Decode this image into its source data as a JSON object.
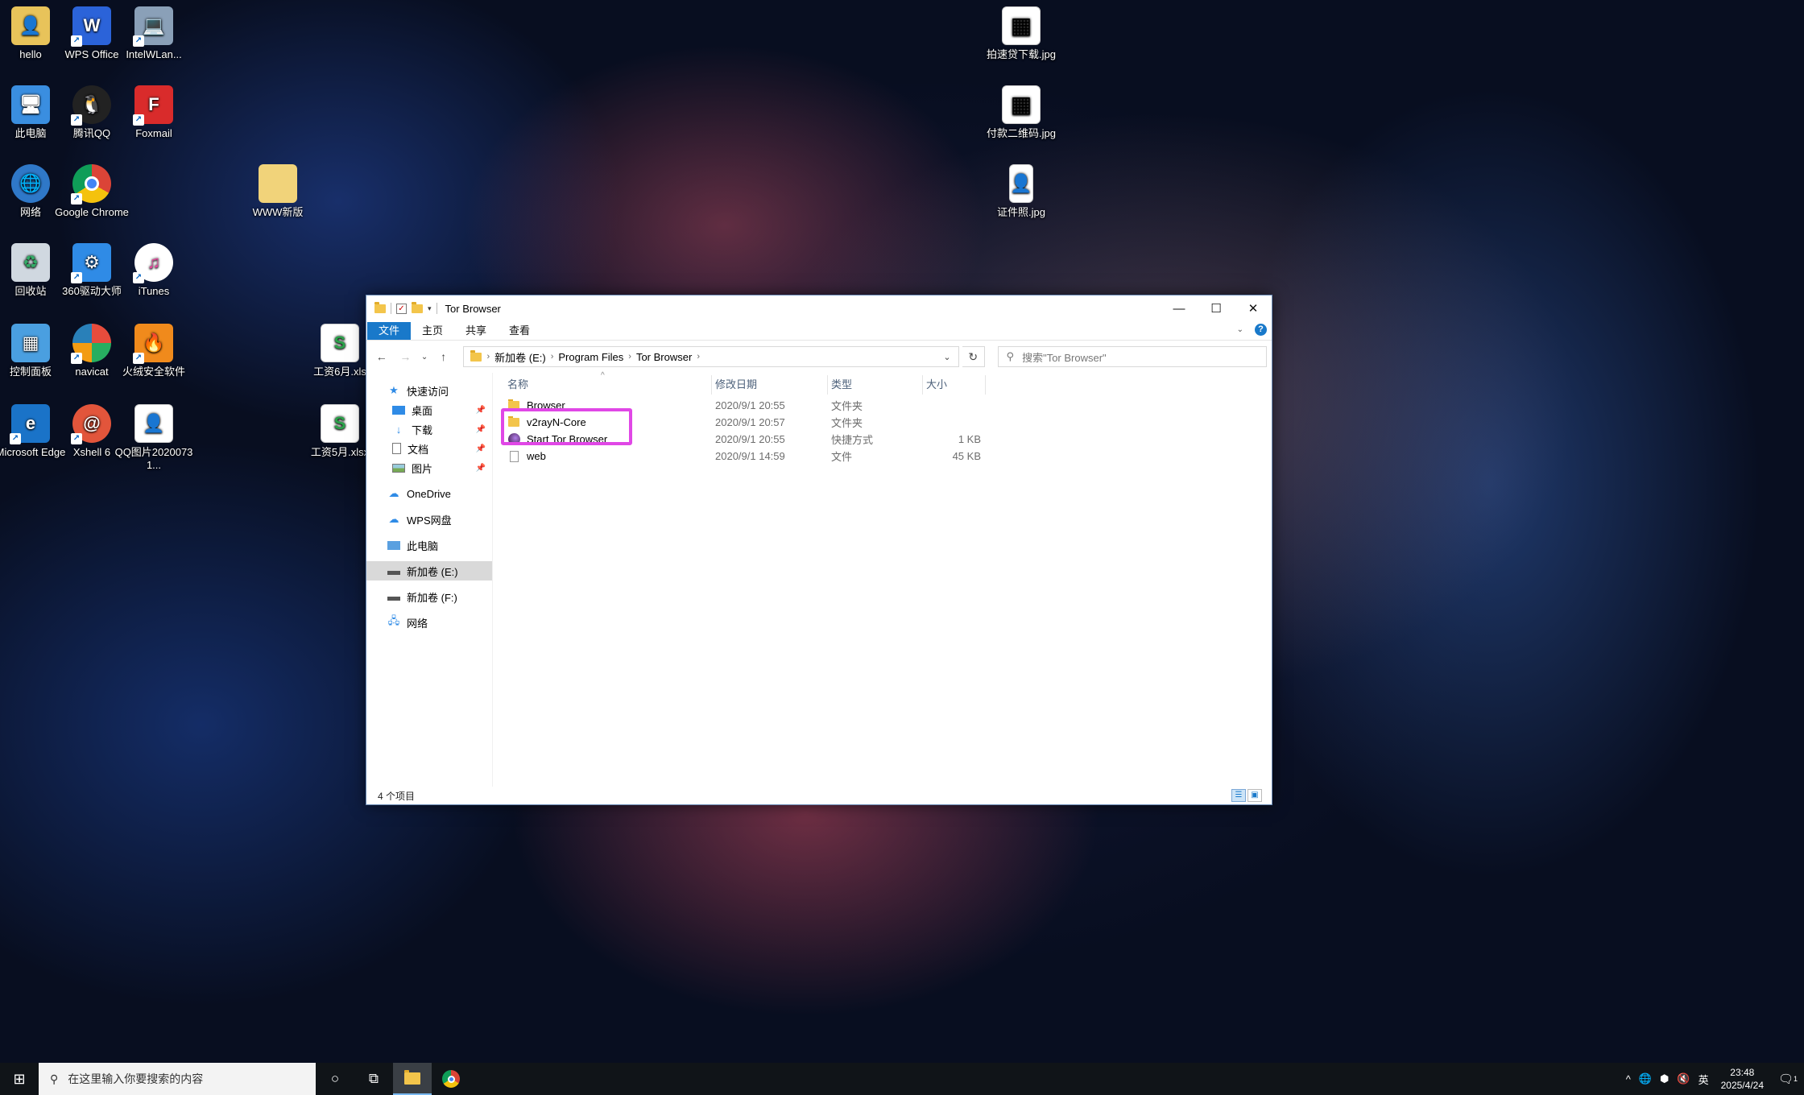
{
  "desktop": {
    "icons": [
      {
        "label": "hello"
      },
      {
        "label": "WPS Office"
      },
      {
        "label": "IntelWLan..."
      },
      {
        "label": "此电脑"
      },
      {
        "label": "腾讯QQ"
      },
      {
        "label": "Foxmail"
      },
      {
        "label": "网络"
      },
      {
        "label": "Google Chrome"
      },
      {
        "label": "WWW新版"
      },
      {
        "label": "回收站"
      },
      {
        "label": "360驱动大师"
      },
      {
        "label": "iTunes"
      },
      {
        "label": "控制面板"
      },
      {
        "label": "navicat"
      },
      {
        "label": "火绒安全软件"
      },
      {
        "label": "工资6月.xls"
      },
      {
        "label": "Microsoft Edge"
      },
      {
        "label": "Xshell 6"
      },
      {
        "label": "QQ图片20200731..."
      },
      {
        "label": "工资5月.xlsx"
      },
      {
        "label": "拍速贷下载.jpg"
      },
      {
        "label": "付款二维码.jpg"
      },
      {
        "label": "证件照.jpg"
      }
    ]
  },
  "explorer": {
    "title": "Tor Browser",
    "ribbon_tabs": [
      "文件",
      "主页",
      "共享",
      "查看"
    ],
    "address": {
      "crumbs": [
        "新加卷 (E:)",
        "Program Files",
        "Tor Browser"
      ]
    },
    "search_placeholder": "搜索\"Tor Browser\"",
    "nav_pane": {
      "items": [
        {
          "label": "快速访问"
        },
        {
          "label": "桌面"
        },
        {
          "label": "下载"
        },
        {
          "label": "文档"
        },
        {
          "label": "图片"
        },
        {
          "label": "OneDrive"
        },
        {
          "label": "WPS网盘"
        },
        {
          "label": "此电脑"
        },
        {
          "label": "新加卷 (E:)"
        },
        {
          "label": "新加卷 (F:)"
        },
        {
          "label": "网络"
        }
      ]
    },
    "columns": [
      "名称",
      "修改日期",
      "类型",
      "大小"
    ],
    "files": [
      {
        "name": "Browser",
        "date": "2020/9/1 20:55",
        "type": "文件夹",
        "size": ""
      },
      {
        "name": "v2rayN-Core",
        "date": "2020/9/1 20:57",
        "type": "文件夹",
        "size": ""
      },
      {
        "name": "Start Tor Browser",
        "date": "2020/9/1 20:55",
        "type": "快捷方式",
        "size": "1 KB"
      },
      {
        "name": "web",
        "date": "2020/9/1 14:59",
        "type": "文件",
        "size": "45 KB"
      }
    ],
    "status": "4 个项目"
  },
  "taskbar": {
    "search_placeholder": "在这里输入你要搜索的内容",
    "ime": "英",
    "time": "23:48",
    "date": "2025/4/24",
    "notification_count": "1"
  }
}
